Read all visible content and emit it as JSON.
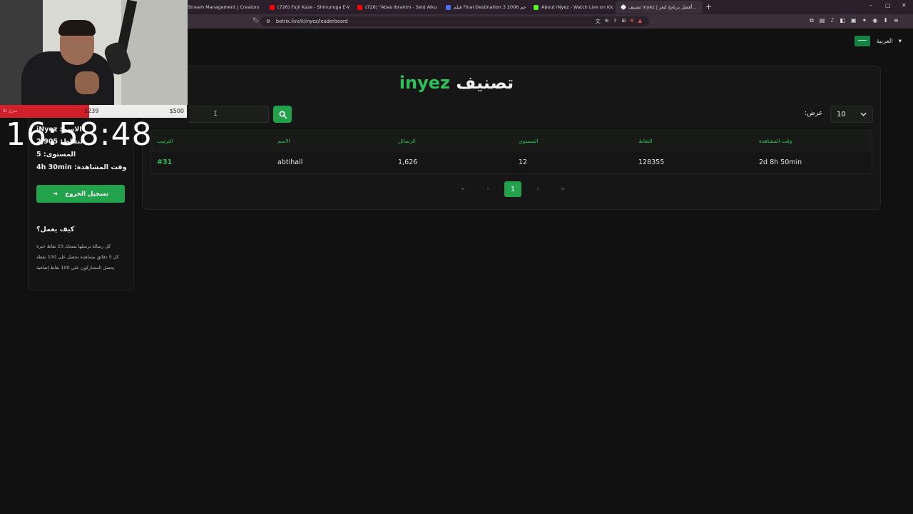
{
  "browser": {
    "tabs": [
      {
        "label": "Stream Management | Creators",
        "color": "#53fc18"
      },
      {
        "label": "(726) Fujii Kaze - Shinunoga E-Wa -",
        "color": "#ff0000"
      },
      {
        "label": "(726) \"Abas Ibrahim - Seid Alkul",
        "color": "#ff0000"
      },
      {
        "label": "فيلم Final Destination 3 2006 مترجم",
        "color": "#4f6ef7"
      },
      {
        "label": "About iNyez - Watch Live on Kick",
        "color": "#53fc18"
      },
      {
        "label": "تصنيف inyez | أفضل برنامج لتعز...",
        "color": "#ffffff"
      }
    ],
    "url": "botrix.live/k/inyez/leaderboard",
    "new_tab": "+",
    "window_controls": [
      "–",
      "▢",
      "✕"
    ]
  },
  "language": {
    "label": "العربية",
    "caret": "▾"
  },
  "leaderboard": {
    "title_name": "inyez",
    "title_word": "تصنيف",
    "show_label": ":عرض",
    "show_value": "10",
    "columns": [
      "الترتيب",
      "الاسم",
      "الرسائل",
      "المستوى",
      "النقاط",
      "وقت المشاهدة"
    ],
    "rows": [
      {
        "rank": "#31",
        "name": "abtihall",
        "messages": "1,626",
        "level": "12",
        "points": "128355",
        "watchtime": "2d 8h 50min"
      }
    ],
    "pagination": {
      "first": "«",
      "prev": "‹",
      "current": "1",
      "next": "›",
      "last": "»"
    }
  },
  "sidebar": {
    "name_line": "الاسم: iNyez",
    "points_line": "النقاط: 2,905",
    "level_line": "المستوى: 5",
    "watch_line": "وقت المشاهدة: 4h 30min",
    "logout_label": "تسجيل الخروج",
    "how_title": "كيف يعمل؟",
    "how_items": [
      "كل رسالة ترسلها تمنحك 10 نقاط خبرة",
      "كل 5 دقائق مشاهدة تحصل على 100 نقطة",
      "يحصل المشاركون على 100 نقاط إضافية"
    ]
  },
  "overlay": {
    "goal_left": "سرى للأ",
    "goal_current": "$239",
    "goal_target": "$500",
    "goal_progress": 0.478,
    "clock": "16:58:48",
    "accent": "#22a24a",
    "danger": "#d1202a"
  }
}
